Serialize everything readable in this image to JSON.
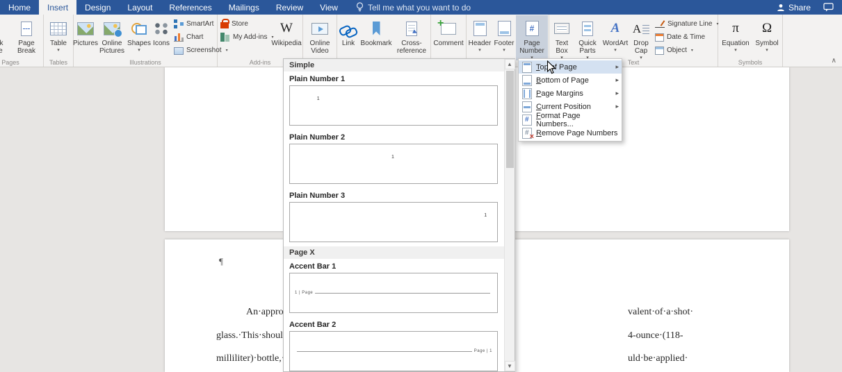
{
  "icons": {
    "dropdown": "▾",
    "submenu": "▸",
    "scroll_up": "▲",
    "scroll_down": "▼",
    "collapse_ribbon": "∧",
    "wikipedia_w": "W",
    "wordart_a": "A",
    "dropcap_a": "A",
    "equation_pi": "π",
    "symbol_omega": "Ω",
    "page_number_hash": "#"
  },
  "tabbar": {
    "tabs": [
      "Home",
      "Insert",
      "Design",
      "Layout",
      "References",
      "Mailings",
      "Review",
      "View"
    ],
    "active_tab": "Insert",
    "tell_me": "Tell me what you want to do",
    "share": "Share"
  },
  "ribbon": {
    "groups": {
      "pages": {
        "label": "Pages",
        "blank_page": "Blank Page",
        "page_break": "Page Break"
      },
      "tables": {
        "label": "Tables",
        "table": "Table"
      },
      "illustrations": {
        "label": "Illustrations",
        "pictures": "Pictures",
        "online_pictures": "Online Pictures",
        "shapes": "Shapes",
        "icons": "Icons",
        "smartart": "SmartArt",
        "chart": "Chart",
        "screenshot": "Screenshot"
      },
      "addins": {
        "label": "Add-ins",
        "store": "Store",
        "my_addins": "My Add-ins",
        "wikipedia": "Wikipedia"
      },
      "media": {
        "online_video": "Online Video"
      },
      "links": {
        "link": "Link",
        "bookmark": "Bookmark",
        "cross_reference": "Cross-reference"
      },
      "comments": {
        "comment": "Comment"
      },
      "header_footer": {
        "header": "Header",
        "footer": "Footer",
        "page_number": "Page Number"
      },
      "text": {
        "label": "Text",
        "text_box": "Text Box",
        "quick_parts": "Quick Parts",
        "wordart": "WordArt",
        "drop_cap": "Drop Cap",
        "signature_line": "Signature Line",
        "date_time": "Date & Time",
        "object": "Object"
      },
      "symbols": {
        "label": "Symbols",
        "equation": "Equation",
        "symbol": "Symbol"
      }
    }
  },
  "page_number_menu": {
    "items": [
      {
        "key": "T",
        "rest": "op of Page"
      },
      {
        "key": "B",
        "rest": "ottom of Page"
      },
      {
        "key": "P",
        "rest": "age Margins"
      },
      {
        "key": "C",
        "rest": "urrent Position"
      },
      {
        "key": "F",
        "rest": "ormat Page Numbers..."
      },
      {
        "key": "R",
        "rest": "emove Page Numbers"
      }
    ]
  },
  "gallery": {
    "section_simple": "Simple",
    "section_page_x": "Page X",
    "plain1": {
      "name": "Plain Number 1",
      "number": "1"
    },
    "plain2": {
      "name": "Plain Number 2",
      "number": "1"
    },
    "plain3": {
      "name": "Plain Number 3",
      "number": "1"
    },
    "accent1": {
      "name": "Accent Bar 1",
      "preview": "1 | Page"
    },
    "accent2": {
      "name": "Accent Bar 2",
      "preview": "Page | 1"
    }
  },
  "document": {
    "pilcrow": "¶",
    "line1_left": "An·approp",
    "line1_right": "valent·of·a·shot·",
    "line2_left": "glass.·This·should·b",
    "line2_right": "4-ounce·(118-",
    "line3_left": "milliliter)·bottle,·o",
    "line3_right": "uld·be·applied·"
  }
}
